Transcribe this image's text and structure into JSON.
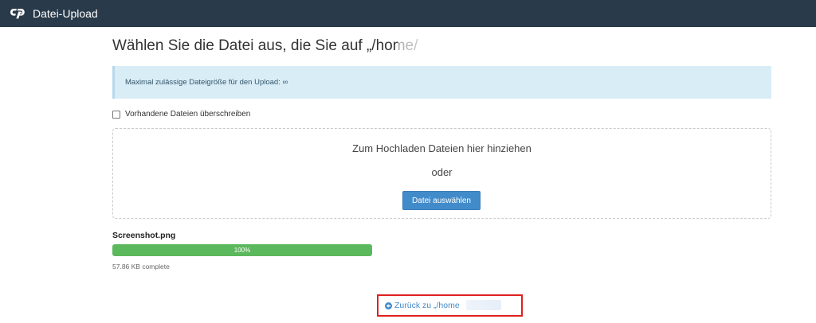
{
  "header": {
    "title": "Datei-Upload",
    "logo_icon": "cpanel-logo-icon",
    "background": "#293a4a"
  },
  "main": {
    "heading": "Wählen Sie die Datei aus, die Sie auf „/home/",
    "info": "Maximal zulässige Dateigröße für den Upload: ∞",
    "overwrite_label": "Vorhandene Dateien überschreiben",
    "overwrite_checked": false,
    "dropzone": {
      "drag_text": "Zum Hochladen Dateien hier hinziehen",
      "or_text": "oder",
      "choose_button": "Datei auswählen"
    },
    "upload": {
      "file_name": "Screenshot.png",
      "progress_percent": 100,
      "progress_label": "100%",
      "status": "57.86 KB complete"
    },
    "back_link": {
      "label": "Zurück zu „/home",
      "icon": "arrow-left-circle-icon"
    }
  },
  "colors": {
    "accent": "#428bca",
    "progress": "#5cb85c",
    "info_bg": "#d9edf7",
    "highlight": "#e02020"
  }
}
